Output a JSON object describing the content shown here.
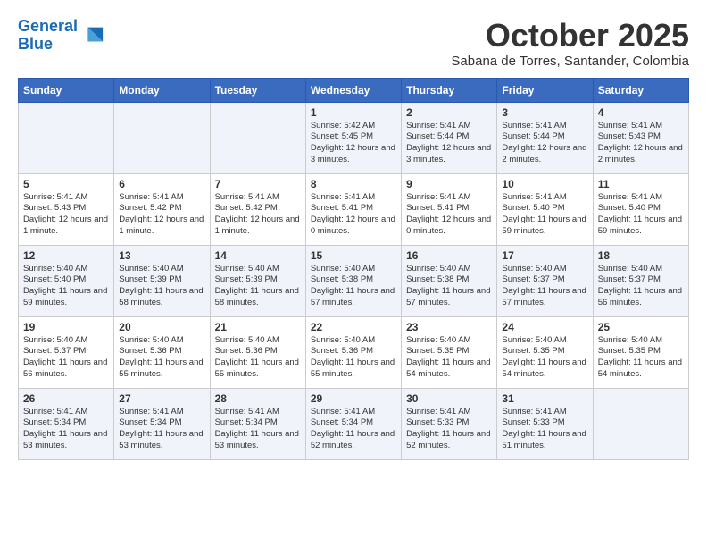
{
  "header": {
    "logo_line1": "General",
    "logo_line2": "Blue",
    "month": "October 2025",
    "location": "Sabana de Torres, Santander, Colombia"
  },
  "weekdays": [
    "Sunday",
    "Monday",
    "Tuesday",
    "Wednesday",
    "Thursday",
    "Friday",
    "Saturday"
  ],
  "weeks": [
    [
      {
        "day": "",
        "info": ""
      },
      {
        "day": "",
        "info": ""
      },
      {
        "day": "",
        "info": ""
      },
      {
        "day": "1",
        "info": "Sunrise: 5:42 AM\nSunset: 5:45 PM\nDaylight: 12 hours and 3 minutes."
      },
      {
        "day": "2",
        "info": "Sunrise: 5:41 AM\nSunset: 5:44 PM\nDaylight: 12 hours and 3 minutes."
      },
      {
        "day": "3",
        "info": "Sunrise: 5:41 AM\nSunset: 5:44 PM\nDaylight: 12 hours and 2 minutes."
      },
      {
        "day": "4",
        "info": "Sunrise: 5:41 AM\nSunset: 5:43 PM\nDaylight: 12 hours and 2 minutes."
      }
    ],
    [
      {
        "day": "5",
        "info": "Sunrise: 5:41 AM\nSunset: 5:43 PM\nDaylight: 12 hours and 1 minute."
      },
      {
        "day": "6",
        "info": "Sunrise: 5:41 AM\nSunset: 5:42 PM\nDaylight: 12 hours and 1 minute."
      },
      {
        "day": "7",
        "info": "Sunrise: 5:41 AM\nSunset: 5:42 PM\nDaylight: 12 hours and 1 minute."
      },
      {
        "day": "8",
        "info": "Sunrise: 5:41 AM\nSunset: 5:41 PM\nDaylight: 12 hours and 0 minutes."
      },
      {
        "day": "9",
        "info": "Sunrise: 5:41 AM\nSunset: 5:41 PM\nDaylight: 12 hours and 0 minutes."
      },
      {
        "day": "10",
        "info": "Sunrise: 5:41 AM\nSunset: 5:40 PM\nDaylight: 11 hours and 59 minutes."
      },
      {
        "day": "11",
        "info": "Sunrise: 5:41 AM\nSunset: 5:40 PM\nDaylight: 11 hours and 59 minutes."
      }
    ],
    [
      {
        "day": "12",
        "info": "Sunrise: 5:40 AM\nSunset: 5:40 PM\nDaylight: 11 hours and 59 minutes."
      },
      {
        "day": "13",
        "info": "Sunrise: 5:40 AM\nSunset: 5:39 PM\nDaylight: 11 hours and 58 minutes."
      },
      {
        "day": "14",
        "info": "Sunrise: 5:40 AM\nSunset: 5:39 PM\nDaylight: 11 hours and 58 minutes."
      },
      {
        "day": "15",
        "info": "Sunrise: 5:40 AM\nSunset: 5:38 PM\nDaylight: 11 hours and 57 minutes."
      },
      {
        "day": "16",
        "info": "Sunrise: 5:40 AM\nSunset: 5:38 PM\nDaylight: 11 hours and 57 minutes."
      },
      {
        "day": "17",
        "info": "Sunrise: 5:40 AM\nSunset: 5:37 PM\nDaylight: 11 hours and 57 minutes."
      },
      {
        "day": "18",
        "info": "Sunrise: 5:40 AM\nSunset: 5:37 PM\nDaylight: 11 hours and 56 minutes."
      }
    ],
    [
      {
        "day": "19",
        "info": "Sunrise: 5:40 AM\nSunset: 5:37 PM\nDaylight: 11 hours and 56 minutes."
      },
      {
        "day": "20",
        "info": "Sunrise: 5:40 AM\nSunset: 5:36 PM\nDaylight: 11 hours and 55 minutes."
      },
      {
        "day": "21",
        "info": "Sunrise: 5:40 AM\nSunset: 5:36 PM\nDaylight: 11 hours and 55 minutes."
      },
      {
        "day": "22",
        "info": "Sunrise: 5:40 AM\nSunset: 5:36 PM\nDaylight: 11 hours and 55 minutes."
      },
      {
        "day": "23",
        "info": "Sunrise: 5:40 AM\nSunset: 5:35 PM\nDaylight: 11 hours and 54 minutes."
      },
      {
        "day": "24",
        "info": "Sunrise: 5:40 AM\nSunset: 5:35 PM\nDaylight: 11 hours and 54 minutes."
      },
      {
        "day": "25",
        "info": "Sunrise: 5:40 AM\nSunset: 5:35 PM\nDaylight: 11 hours and 54 minutes."
      }
    ],
    [
      {
        "day": "26",
        "info": "Sunrise: 5:41 AM\nSunset: 5:34 PM\nDaylight: 11 hours and 53 minutes."
      },
      {
        "day": "27",
        "info": "Sunrise: 5:41 AM\nSunset: 5:34 PM\nDaylight: 11 hours and 53 minutes."
      },
      {
        "day": "28",
        "info": "Sunrise: 5:41 AM\nSunset: 5:34 PM\nDaylight: 11 hours and 53 minutes."
      },
      {
        "day": "29",
        "info": "Sunrise: 5:41 AM\nSunset: 5:34 PM\nDaylight: 11 hours and 52 minutes."
      },
      {
        "day": "30",
        "info": "Sunrise: 5:41 AM\nSunset: 5:33 PM\nDaylight: 11 hours and 52 minutes."
      },
      {
        "day": "31",
        "info": "Sunrise: 5:41 AM\nSunset: 5:33 PM\nDaylight: 11 hours and 51 minutes."
      },
      {
        "day": "",
        "info": ""
      }
    ]
  ]
}
